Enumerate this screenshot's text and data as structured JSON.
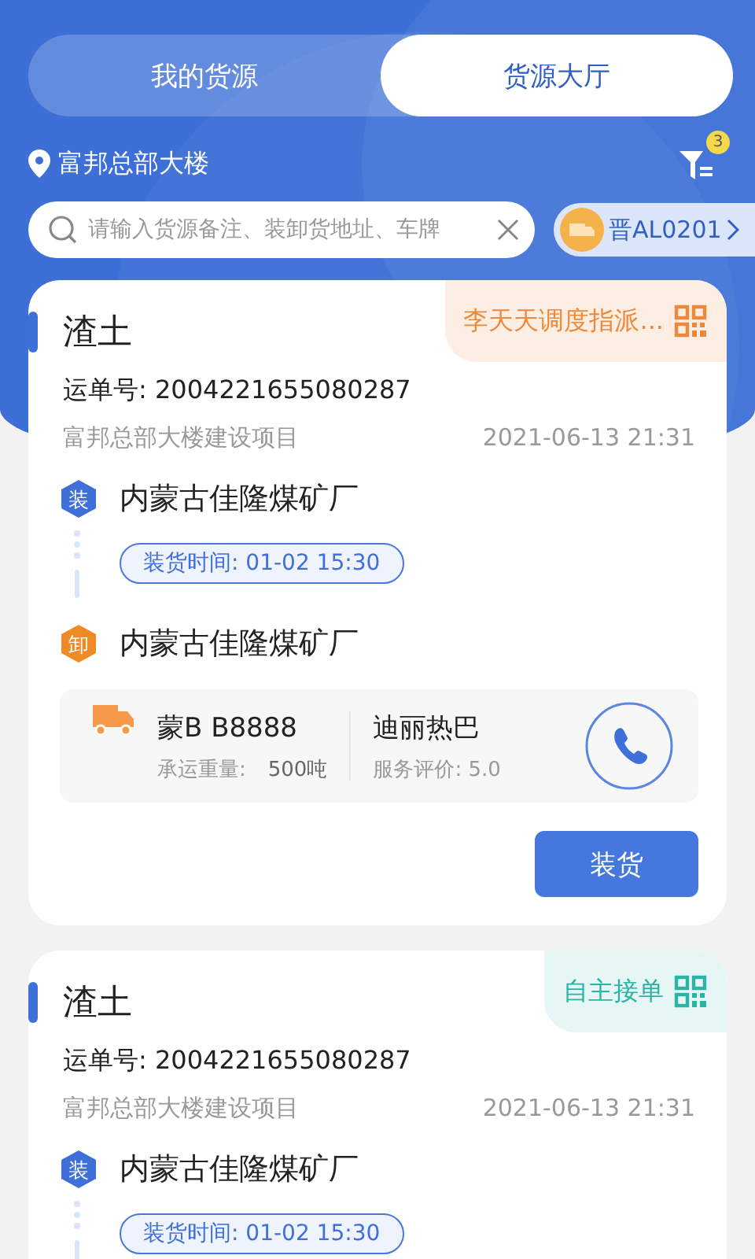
{
  "tabs": [
    {
      "label": "我的货源",
      "selected": false
    },
    {
      "label": "货源大厅",
      "selected": true
    }
  ],
  "location": "富邦总部大楼",
  "filter": {
    "badge": "3"
  },
  "search": {
    "placeholder": "请输入货源备注、装卸货地址、车牌"
  },
  "vehicle_chip": "晋AL0201",
  "cards": [
    {
      "title": "渣土",
      "tag": {
        "kind": "dispatch",
        "text": "李天天调度指派..."
      },
      "waybill": "运单号: 2004221655080287",
      "project": "富邦总部大楼建设项目",
      "time": "2021-06-13 21:31",
      "stops": [
        {
          "kind": "load",
          "badge": "装",
          "place": "内蒙古佳隆煤矿厂",
          "pill": "装货时间: 01-02 15:30"
        },
        {
          "kind": "unload",
          "badge": "卸",
          "place": "内蒙古佳隆煤矿厂"
        }
      ],
      "driver": {
        "plate": "蒙B B8888",
        "weight_label": "承运重量:",
        "weight": "500吨",
        "name": "迪丽热巴",
        "rating": "服务评价: 5.0"
      },
      "action": "装货"
    },
    {
      "title": "渣土",
      "tag": {
        "kind": "self",
        "text": "自主接单"
      },
      "waybill": "运单号: 2004221655080287",
      "project": "富邦总部大楼建设项目",
      "time": "2021-06-13 21:31",
      "stops": [
        {
          "kind": "load",
          "badge": "装",
          "place": "内蒙古佳隆煤矿厂",
          "pill": "装货时间: 01-02 15:30"
        }
      ]
    }
  ]
}
